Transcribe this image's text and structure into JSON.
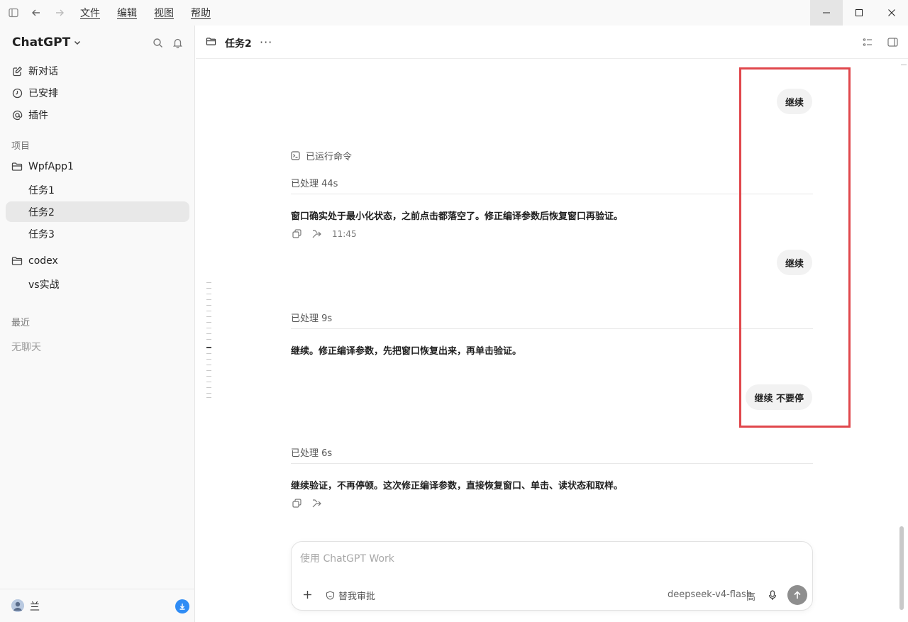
{
  "menu": [
    "文件",
    "编辑",
    "视图",
    "帮助"
  ],
  "sidebar": {
    "brand": "ChatGPT",
    "nav": [
      {
        "label": "新对话",
        "icon": "edit-icon"
      },
      {
        "label": "已安排",
        "icon": "clock-icon"
      },
      {
        "label": "插件",
        "icon": "at-icon"
      }
    ],
    "projects_label": "项目",
    "projects": [
      {
        "name": "WpfApp1",
        "tasks": [
          "任务1",
          "任务2",
          "任务3"
        ]
      },
      {
        "name": "codex",
        "tasks": [
          "vs实战"
        ]
      }
    ],
    "active_task": "任务2",
    "recent_label": "最近",
    "recent_empty": "无聊天",
    "user_name": "兰"
  },
  "header": {
    "title": "任务2"
  },
  "chat": {
    "bubble1": "继续",
    "ran_command": "已运行命令",
    "proc1": "已处理 44s",
    "msg1": "窗口确实处于最小化状态，之前点击都落空了。修正编译参数后恢复窗口再验证。",
    "time1": "11:45",
    "bubble2": "继续",
    "proc2": "已处理 9s",
    "msg2": "继续。修正编译参数，先把窗口恢复出来，再单击验证。",
    "bubble3": "继续 不要停",
    "proc3": "已处理 6s",
    "msg3": "继续验证，不再停顿。这次修正编译参数，直接恢复窗口、单击、读状态和取样。"
  },
  "composer": {
    "placeholder": "使用 ChatGPT Work",
    "approve_label": "替我审批",
    "model": "deepseek-v4-flash",
    "effort": "高"
  },
  "colors": {
    "highlight": "#e0474c",
    "accent": "#2f8cf5"
  }
}
